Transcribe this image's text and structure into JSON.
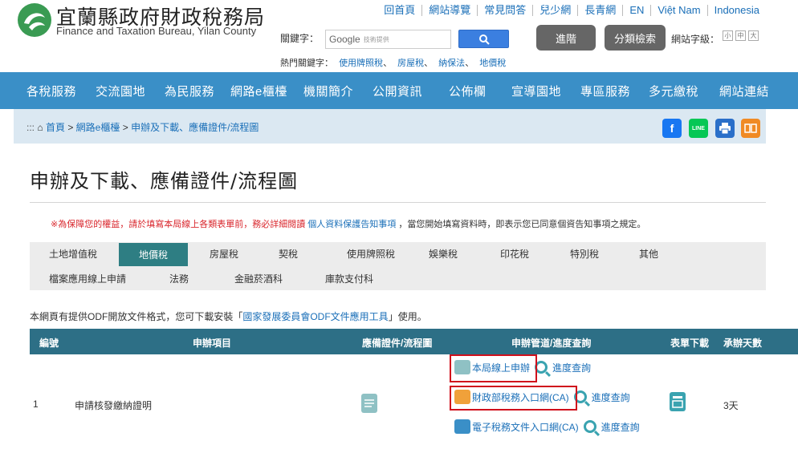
{
  "header": {
    "title": "宜蘭縣政府財政稅務局",
    "subtitle": "Finance and Taxation Bureau, Yilan County",
    "top_links": [
      "回首頁",
      "網站導覽",
      "常見問答",
      "兒少網",
      "長青網",
      "EN",
      "Việt Nam",
      "Indonesia"
    ],
    "keyword_label": "關鍵字：",
    "search_brand": "Google",
    "search_sub": "技術提供",
    "advanced_label": "進階",
    "category_label": "分類檢索",
    "fontsize_label": "網站字級：",
    "fontsize_options": [
      "小",
      "中",
      "大"
    ],
    "hot_label": "熱門關鍵字：",
    "hot_keywords": [
      "使用牌照稅",
      "房屋稅",
      "納保法",
      "地價稅"
    ]
  },
  "nav": [
    "各稅服務",
    "交流園地",
    "為民服務",
    "網路e櫃檯",
    "機關簡介",
    "公開資訊",
    "公佈欄",
    "宣導園地",
    "專區服務",
    "多元繳稅",
    "網站連結"
  ],
  "breadcrumb": {
    "prefix": ":::",
    "items": [
      "首頁",
      "網路e櫃檯",
      "申辦及下載、應備證件/流程圖"
    ],
    "separator": ">"
  },
  "social": {
    "facebook": "f",
    "line": "LINE",
    "print": "print-icon",
    "share": "share-icon"
  },
  "page": {
    "title": "申辦及下載、應備證件/流程圖",
    "notice_red": "※為保障您的權益，請於填寫本局線上各類表單前，務必詳細閱讀",
    "notice_link": "個人資料保護告知事項",
    "notice_rest": "，當您開始填寫資料時，即表示您已同意個資告知事項之規定。"
  },
  "tabs": {
    "row1": [
      "土地增值稅",
      "地價稅",
      "房屋稅",
      "契稅",
      "使用牌照稅",
      "娛樂稅",
      "印花稅",
      "特別稅",
      "其他"
    ],
    "row2": [
      "檔案應用線上申請",
      "法務",
      "金融菸酒科",
      "庫款支付科"
    ],
    "active": "地價稅"
  },
  "odf": {
    "prefix": "本網頁有提供ODF開放文件格式，您可下載安裝「",
    "link": "國家發展委員會ODF文件應用工具",
    "suffix": "」使用。"
  },
  "table": {
    "headers": [
      "編號",
      "申辦項目",
      "應備證件/流程圖",
      "申辦管道/進度查詢",
      "表單下載",
      "承辦天數"
    ],
    "rows": [
      {
        "no": "1",
        "item": "申請核發繳納證明",
        "channels": [
          {
            "label": "本局線上申辦",
            "query": "進度查詢"
          },
          {
            "label": "財政部稅務入口網(CA)",
            "query": "進度查詢"
          },
          {
            "label": "電子稅務文件入口網(CA)",
            "query": "進度查詢"
          }
        ],
        "days": "3天"
      }
    ]
  },
  "colors": {
    "nav_bg": "#3a8fc7",
    "table_header": "#2d6f86",
    "active_tab": "#2e7e83",
    "highlight": "#d0101c"
  }
}
